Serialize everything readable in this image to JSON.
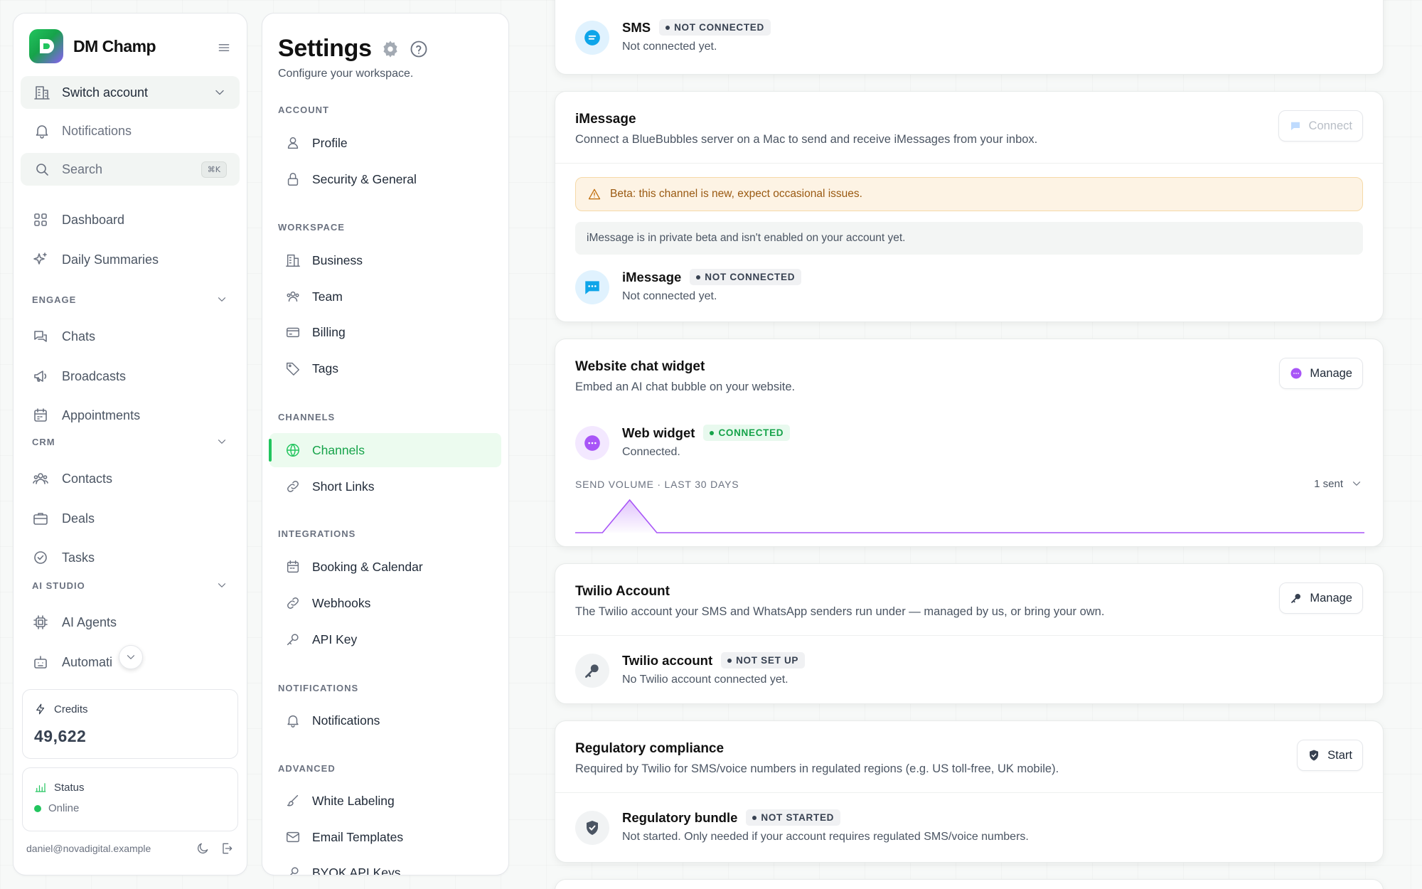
{
  "sidebar": {
    "brand": "DM Champ",
    "switch_account": "Switch account",
    "notifications": "Notifications",
    "search": "Search",
    "search_shortcut": "⌘K",
    "nav": {
      "dashboard": "Dashboard",
      "daily_summaries": "Daily Summaries",
      "engage_header": "ENGAGE",
      "chats": "Chats",
      "broadcasts": "Broadcasts",
      "appointments": "Appointments",
      "crm_header": "CRM",
      "contacts": "Contacts",
      "deals": "Deals",
      "tasks": "Tasks",
      "ai_studio_header": "AI STUDIO",
      "ai_agents": "AI Agents",
      "automations": "Automati"
    },
    "credits_label": "Credits",
    "credits_value": "49,622",
    "status_label": "Status",
    "status_value": "Online",
    "user_email": "daniel@novadigital.example"
  },
  "settings": {
    "title": "Settings",
    "subtitle": "Configure your workspace.",
    "sections": {
      "account": "ACCOUNT",
      "workspace": "WORKSPACE",
      "channels": "CHANNELS",
      "integrations": "INTEGRATIONS",
      "notifications": "NOTIFICATIONS",
      "advanced": "ADVANCED"
    },
    "items": {
      "profile": "Profile",
      "security": "Security & General",
      "business": "Business",
      "team": "Team",
      "billing": "Billing",
      "tags": "Tags",
      "channels": "Channels",
      "short_links": "Short Links",
      "booking": "Booking & Calendar",
      "webhooks": "Webhooks",
      "api_key": "API Key",
      "notifications": "Notifications",
      "white_labeling": "White Labeling",
      "email_templates": "Email Templates",
      "byok": "BYOK API Keys"
    }
  },
  "main": {
    "sms": {
      "name": "SMS",
      "badge": "NOT CONNECTED",
      "status": "Not connected yet."
    },
    "imessage": {
      "title": "iMessage",
      "description": "Connect a BlueBubbles server on a Mac to send and receive iMessages from your inbox.",
      "button": "Connect",
      "warning": "Beta: this channel is new, expect occasional issues.",
      "note": "iMessage is in private beta and isn't enabled on your account yet.",
      "name": "iMessage",
      "badge": "NOT CONNECTED",
      "status": "Not connected yet."
    },
    "widget": {
      "title": "Website chat widget",
      "description": "Embed an AI chat bubble on your website.",
      "button": "Manage",
      "name": "Web widget",
      "badge": "CONNECTED",
      "status": "Connected.",
      "volume_label": "SEND VOLUME · LAST 30 DAYS",
      "volume_total": "1 sent"
    },
    "twilio": {
      "title": "Twilio Account",
      "description": "The Twilio account your SMS and WhatsApp senders run under — managed by us, or bring your own.",
      "button": "Manage",
      "name": "Twilio account",
      "badge": "NOT SET UP",
      "status": "No Twilio account connected yet."
    },
    "regulatory": {
      "title": "Regulatory compliance",
      "description": "Required by Twilio for SMS/voice numbers in regulated regions (e.g. US toll-free, UK mobile).",
      "button": "Start",
      "name": "Regulatory bundle",
      "badge": "NOT STARTED",
      "status": "Not started. Only needed if your account requires regulated SMS/voice numbers."
    }
  },
  "sparkline": {
    "values": [
      0,
      0,
      1,
      0,
      0,
      0,
      0,
      0,
      0,
      0,
      0,
      0,
      0,
      0,
      0,
      0,
      0,
      0,
      0,
      0,
      0,
      0,
      0,
      0,
      0,
      0,
      0,
      0,
      0,
      0
    ],
    "color": "#a855f7"
  },
  "colors": {
    "accent": "#22c55e",
    "widget_purple": "#a855f7",
    "sms_blue": "#0ea5e9",
    "warning": "#9a5a12"
  }
}
